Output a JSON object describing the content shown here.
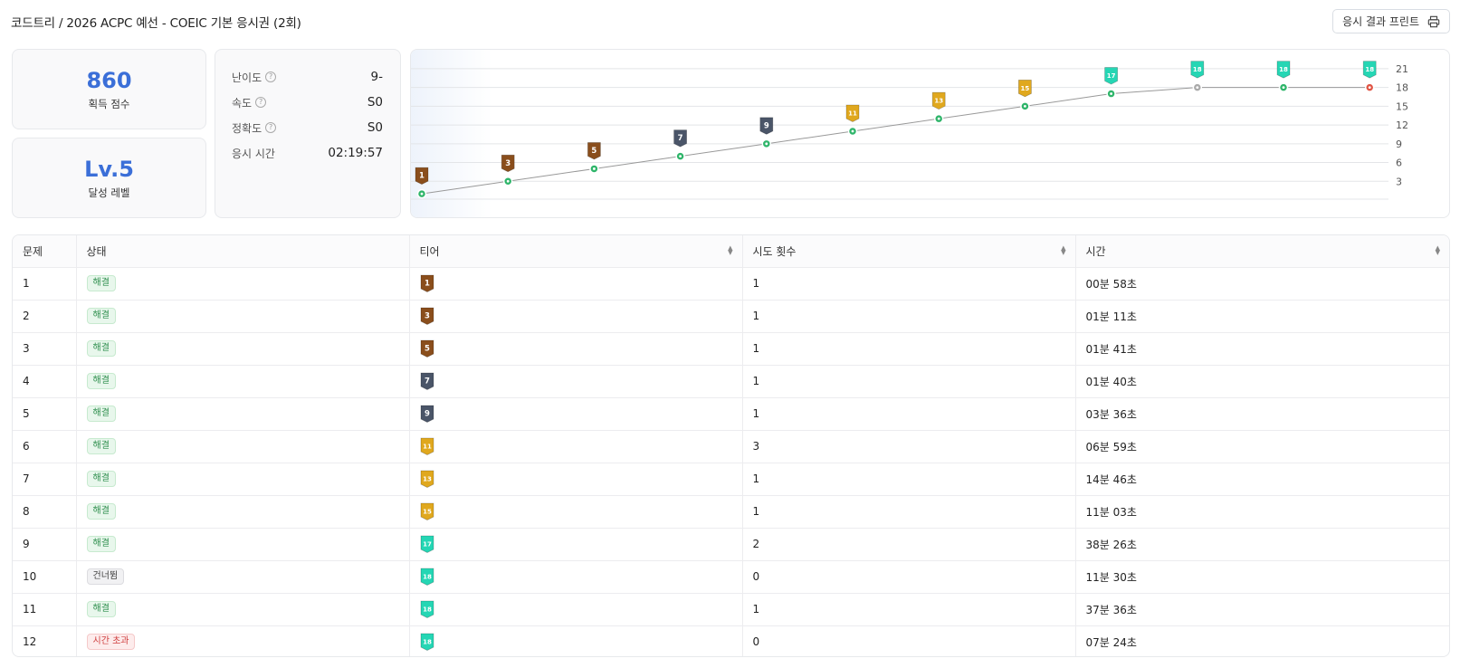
{
  "header": {
    "breadcrumb": "코드트리 / 2026 ACPC 예선 - COEIC 기본 응시권 (2회)",
    "print_label": "응시 결과 프린트"
  },
  "summary": {
    "score": "860",
    "score_label": "획득 점수",
    "level": "Lv.5",
    "level_label": "달성 레벨"
  },
  "stats": [
    {
      "label": "난이도",
      "value": "9-",
      "help": true
    },
    {
      "label": "속도",
      "value": "S0",
      "help": true
    },
    {
      "label": "정확도",
      "value": "S0",
      "help": true
    },
    {
      "label": "응시 시간",
      "value": "02:19:57",
      "help": false
    }
  ],
  "tier_colors": {
    "bronze": "#8a4e1c",
    "silver": "#4a5568",
    "gold": "#e0a81e",
    "platinum": "#25d6b4"
  },
  "chart_data": {
    "type": "line",
    "x": [
      1,
      2,
      3,
      4,
      5,
      6,
      7,
      8,
      9,
      10,
      11,
      12
    ],
    "series": [
      {
        "values": [
          1,
          3,
          5,
          7,
          9,
          11,
          13,
          15,
          17,
          18,
          18,
          18
        ]
      }
    ],
    "point_labels": [
      "1",
      "3",
      "5",
      "7",
      "9",
      "11",
      "13",
      "15",
      "17",
      "18",
      "18",
      "18"
    ],
    "point_status": [
      "solved",
      "solved",
      "solved",
      "solved",
      "solved",
      "solved",
      "solved",
      "solved",
      "solved",
      "skipped",
      "solved",
      "timeout"
    ],
    "point_colors": {
      "solved": "#2fb56a",
      "skipped": "#aaaaaa",
      "timeout": "#e05545"
    },
    "yticks": [
      3,
      6,
      9,
      12,
      15,
      18,
      21
    ],
    "ylim": [
      0,
      22
    ],
    "grid": true,
    "y_axis_side": "right",
    "line_color": "#999999"
  },
  "table": {
    "columns": [
      {
        "label": "문제",
        "sortable": false
      },
      {
        "label": "상태",
        "sortable": false
      },
      {
        "label": "티어",
        "sortable": true
      },
      {
        "label": "시도 횟수",
        "sortable": true
      },
      {
        "label": "시간",
        "sortable": true
      }
    ],
    "rows": [
      {
        "problem": "1",
        "status": "해결",
        "status_type": "solved",
        "tier": "1",
        "tier_color": "bronze",
        "attempts": "1",
        "time": "00분 58초"
      },
      {
        "problem": "2",
        "status": "해결",
        "status_type": "solved",
        "tier": "3",
        "tier_color": "bronze",
        "attempts": "1",
        "time": "01분 11초"
      },
      {
        "problem": "3",
        "status": "해결",
        "status_type": "solved",
        "tier": "5",
        "tier_color": "bronze",
        "attempts": "1",
        "time": "01분 41초"
      },
      {
        "problem": "4",
        "status": "해결",
        "status_type": "solved",
        "tier": "7",
        "tier_color": "silver",
        "attempts": "1",
        "time": "01분 40초"
      },
      {
        "problem": "5",
        "status": "해결",
        "status_type": "solved",
        "tier": "9",
        "tier_color": "silver",
        "attempts": "1",
        "time": "03분 36초"
      },
      {
        "problem": "6",
        "status": "해결",
        "status_type": "solved",
        "tier": "11",
        "tier_color": "gold",
        "attempts": "3",
        "time": "06분 59초"
      },
      {
        "problem": "7",
        "status": "해결",
        "status_type": "solved",
        "tier": "13",
        "tier_color": "gold",
        "attempts": "1",
        "time": "14분 46초"
      },
      {
        "problem": "8",
        "status": "해결",
        "status_type": "solved",
        "tier": "15",
        "tier_color": "gold",
        "attempts": "1",
        "time": "11분 03초"
      },
      {
        "problem": "9",
        "status": "해결",
        "status_type": "solved",
        "tier": "17",
        "tier_color": "platinum",
        "attempts": "2",
        "time": "38분 26초"
      },
      {
        "problem": "10",
        "status": "건너뜀",
        "status_type": "skip",
        "tier": "18",
        "tier_color": "platinum",
        "attempts": "0",
        "time": "11분 30초"
      },
      {
        "problem": "11",
        "status": "해결",
        "status_type": "solved",
        "tier": "18",
        "tier_color": "platinum",
        "attempts": "1",
        "time": "37분 36초"
      },
      {
        "problem": "12",
        "status": "시간 초과",
        "status_type": "timeout",
        "tier": "18",
        "tier_color": "platinum",
        "attempts": "0",
        "time": "07분 24초"
      }
    ]
  }
}
